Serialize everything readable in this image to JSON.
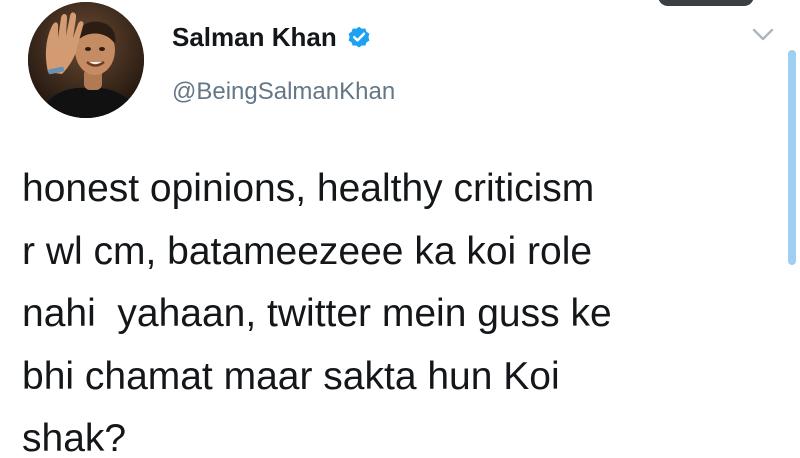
{
  "tweet": {
    "author": {
      "display_name": "Salman Khan",
      "handle": "@BeingSalmanKhan",
      "verified": true,
      "avatar_icon": "profile-photo",
      "verified_color": "#1da1f2"
    },
    "text_lines": [
      "honest opinions, healthy criticism",
      "r wl cm, batameezeee ka koi role",
      "nahi  yahaan, twitter mein guss ke",
      "bhi chamat maar sakta hun Koi",
      "shak?"
    ],
    "menu_icon": "chevron-down-icon"
  },
  "colors": {
    "text": "#14171a",
    "handle": "#657786",
    "accent": "#1da1f2"
  }
}
